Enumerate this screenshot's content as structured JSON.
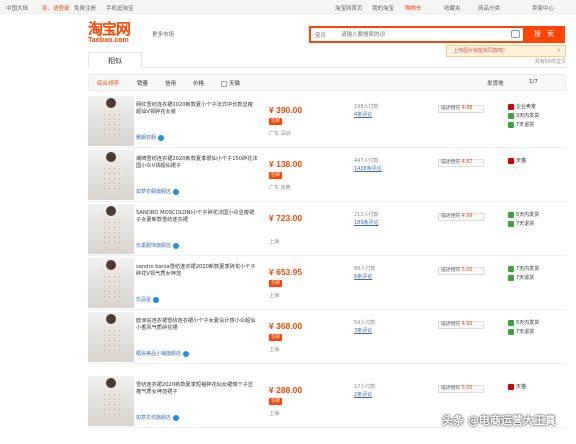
{
  "topbar": {
    "region": "中国大陆",
    "greeting": "亲，请登录",
    "register": "免费注册",
    "mobile": "手机逛淘宝",
    "my_taobao": "淘宝网首页",
    "mytb": "我的淘宝",
    "cart": "购物车",
    "fav": "收藏夹",
    "category": "商品分类",
    "seller": "卖家中心"
  },
  "logo": {
    "cn": "淘宝网",
    "en": "Taobao.com"
  },
  "market": "更多市场",
  "search": {
    "category": "宝贝",
    "placeholder": "请输入要搜索的词",
    "button": "搜 索"
  },
  "tooltip": {
    "text": "上传图片就能找同款啦!",
    "close": "×"
  },
  "tabs": {
    "active": "相似",
    "total": "共有50件宝贝"
  },
  "sortbar": {
    "items": [
      "综合排序",
      "销量",
      "信用",
      "价格"
    ],
    "tmall": "天猫",
    "ship": "发货地",
    "page": "1/7"
  },
  "rows": [
    {
      "title": "网红雪纺连衣裙2020新款夏小个子法式中长款显瘦超仙V领碎花女装",
      "shop": "雅朗衣橱",
      "price": "¥ 390.00",
      "badge": "包邮",
      "loc": "广东 深圳",
      "sold": "198人付款",
      "reviews": "4条评论",
      "desc_label": "描述相符",
      "desc_score": "4.88",
      "services": [
        {
          "icon": "red",
          "text": "企业卖家"
        },
        {
          "icon": "green",
          "text": "3天内发货"
        },
        {
          "icon": "green",
          "text": "7天退货"
        }
      ]
    },
    {
      "title": "潮牌雪纺连衣裙2020新款夏季很仙小个子150碎花法国小众V领超仙裙子",
      "shop": "如梦衣橱旗舰店",
      "price": "¥ 138.00",
      "badge": "包邮",
      "loc": "广东 东莞",
      "sold": "447人付款",
      "reviews": "1428条评论",
      "desc_label": "描述相符",
      "desc_score": "4.87",
      "services": [
        {
          "icon": "red",
          "text": "天猫"
        }
      ]
    },
    {
      "title": "SANDRO MOSCOLONI小个子碎花法国小众显瘦裙子女夏新款雪纺连衣裙",
      "shop": "乐巢服饰旗舰店",
      "price": "¥ 723.00",
      "badge": "",
      "loc": "上海",
      "sold": "212人付款",
      "reviews": "189条评论",
      "desc_label": "描述相符",
      "desc_score": "4.99",
      "services": [
        {
          "icon": "green",
          "text": "5天内发货"
        },
        {
          "icon": "green",
          "text": "7天退货"
        }
      ]
    },
    {
      "title": "sandro barsa雪纺连衣裙2020新款夏季碎花小个子碎花V领气质女神范",
      "shop": "优品屋",
      "price": "¥ 653.95",
      "badge": "包邮",
      "loc": "上海",
      "sold": "98人付款",
      "reviews": "6条评论",
      "desc_label": "描述相符",
      "desc_score": "5.00",
      "services": [
        {
          "icon": "green",
          "text": "7天内发货"
        },
        {
          "icon": "green",
          "text": "7天退货"
        }
      ]
    },
    {
      "title": "欧洲站连衣裙雪纺连衣裙小个子女夏设计感小众超仙小香风气质碎花裙",
      "shop": "都会美品小铺旗舰店",
      "price": "¥ 368.00",
      "badge": "包邮",
      "loc": "上海",
      "sold": "54人付款",
      "reviews": "3条评论",
      "desc_label": "描述相符",
      "desc_score": "4.99",
      "services": [
        {
          "icon": "green",
          "text": "5天内发货"
        },
        {
          "icon": "green",
          "text": "7天退货"
        }
      ]
    },
    {
      "title": "雪纺连衣裙2020新款夏季短袖碎花仙女裙矮个子显瘦气质女神范裙子",
      "shop": "如意衣坊旗舰店",
      "price": "¥ 288.00",
      "badge": "包邮",
      "loc": "上海",
      "sold": "17人付款",
      "reviews": "2条评论",
      "desc_label": "描述相符",
      "desc_score": "5.00",
      "services": [
        {
          "icon": "red",
          "text": "天猫"
        }
      ]
    }
  ],
  "watermark": "头条 @电商运营大王真"
}
